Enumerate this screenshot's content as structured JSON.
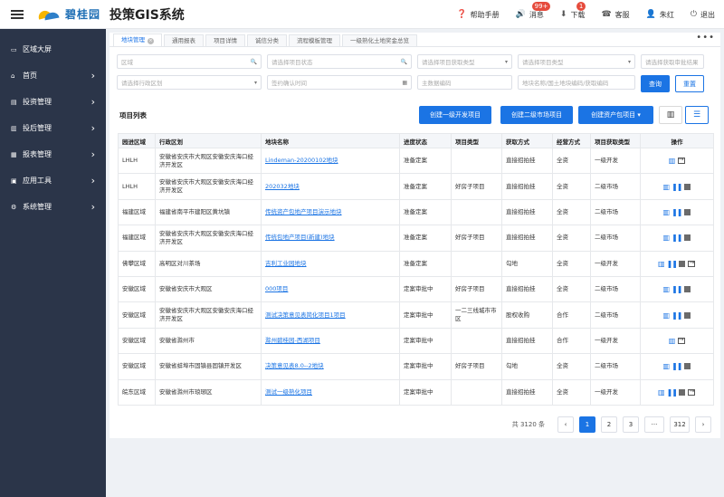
{
  "header": {
    "logo_text": "碧桂园",
    "system_title": "投策GIS系统",
    "actions": [
      {
        "icon": "help-icon",
        "glyph": "❓",
        "label": "帮助手册",
        "badge": ""
      },
      {
        "icon": "message-icon",
        "glyph": "🔊",
        "label": "消息",
        "badge": "99+"
      },
      {
        "icon": "download-icon",
        "glyph": "⬇",
        "label": "下载",
        "badge": "1"
      },
      {
        "icon": "service-icon",
        "glyph": "☎",
        "label": "客服",
        "badge": ""
      },
      {
        "icon": "user-icon",
        "glyph": "👤",
        "label": "朱红",
        "badge": ""
      },
      {
        "icon": "logout-icon",
        "glyph": "⏻",
        "label": "退出",
        "badge": ""
      }
    ]
  },
  "sidebar": {
    "items": [
      {
        "icon": "monitor-icon",
        "glyph": "▭",
        "label": "区域大屏",
        "has_arrow": false
      },
      {
        "icon": "home-icon",
        "glyph": "⌂",
        "label": "首页",
        "has_arrow": true
      },
      {
        "icon": "invest-icon",
        "glyph": "▤",
        "label": "投资管理",
        "has_arrow": true
      },
      {
        "icon": "post-invest-icon",
        "glyph": "▥",
        "label": "投后管理",
        "has_arrow": true
      },
      {
        "icon": "report-icon",
        "glyph": "▦",
        "label": "报表管理",
        "has_arrow": true
      },
      {
        "icon": "tools-icon",
        "glyph": "▣",
        "label": "应用工具",
        "has_arrow": true
      },
      {
        "icon": "settings-icon",
        "glyph": "⚙",
        "label": "系统管理",
        "has_arrow": true
      }
    ],
    "arrow_glyph": "›"
  },
  "tabs": {
    "items": [
      {
        "label": "地块管理",
        "active": true,
        "closable": true
      },
      {
        "label": "通用报表",
        "active": false,
        "closable": false
      },
      {
        "label": "项目详情",
        "active": false,
        "closable": false
      },
      {
        "label": "诚信分类",
        "active": false,
        "closable": false
      },
      {
        "label": "流程模板管理",
        "active": false,
        "closable": false
      },
      {
        "label": "一级熟化土地奖金总览",
        "active": false,
        "closable": false
      }
    ],
    "close_glyph": "×",
    "more_glyph": "•••"
  },
  "filters": {
    "row1": [
      {
        "placeholder": "区域",
        "suffix": "🔍",
        "width": 160
      },
      {
        "placeholder": "请选择项目状态",
        "suffix": "🔍",
        "width": 160
      },
      {
        "placeholder": "请选择项目获取类型",
        "suffix": "▾",
        "width": 105
      },
      {
        "placeholder": "请选择项目类型",
        "suffix": "▾",
        "width": 130
      },
      {
        "placeholder": "请选择获取审批结果",
        "suffix": "",
        "width": 70
      }
    ],
    "row2": [
      {
        "placeholder": "请选择行政区划",
        "suffix": "▾",
        "width": 160
      },
      {
        "placeholder": "签约确认时间",
        "suffix": "▦",
        "width": 160
      },
      {
        "placeholder": "主数据编码",
        "suffix": "",
        "width": 105
      },
      {
        "placeholder": "地块名称/国土地块编码/获取编码",
        "suffix": "",
        "width": 130
      }
    ],
    "search_label": "查询",
    "reset_label": "重置"
  },
  "list": {
    "title": "项目列表",
    "btn_primary_dev": "创建一级开发项目",
    "btn_secondary_market": "创建二级市场项目",
    "btn_asset_package": "创建资产包项目 ▾",
    "view_map_glyph": "▥",
    "view_list_glyph": "☰"
  },
  "table": {
    "columns": [
      "园进区域",
      "行政区划",
      "地块名称",
      "进度状态",
      "项目类型",
      "获取方式",
      "经营方式",
      "项目获取类型",
      "操作"
    ],
    "rows": [
      {
        "region": "LHLH",
        "admin": "安徽省安庆市大观区安徽安庆海口经济开发区",
        "name": "Lindeman-20200102地块",
        "status": "准备定案",
        "ptype": "",
        "method": "直接招拍挂",
        "mode": "全资",
        "acq": "一级开发",
        "ops": [
          "map",
          "exit"
        ]
      },
      {
        "region": "LHLH",
        "admin": "安徽省安庆市大观区安徽安庆海口经济开发区",
        "name": "202032地块",
        "status": "准备定案",
        "ptype": "好房子项目",
        "method": "直接招拍挂",
        "mode": "全资",
        "acq": "二级市场",
        "ops": [
          "map",
          "pause",
          "stop"
        ]
      },
      {
        "region": "福建区域",
        "admin": "福建省南平市建阳区黄坑镇",
        "name": "传统资产包地产项目演示地块",
        "status": "准备定案",
        "ptype": "",
        "method": "直接招拍挂",
        "mode": "全资",
        "acq": "二级市场",
        "ops": [
          "map",
          "pause",
          "stop"
        ]
      },
      {
        "region": "福建区域",
        "admin": "安徽省安庆市大观区安徽安庆海口经济开发区",
        "name": "传统包地产项目(新建)地块",
        "status": "准备定案",
        "ptype": "好房子项目",
        "method": "直接招拍挂",
        "mode": "全资",
        "acq": "二级市场",
        "ops": [
          "map",
          "pause",
          "stop"
        ]
      },
      {
        "region": "佛攀区域",
        "admin": "高明区对川茶场",
        "name": "吉利工业园地块",
        "status": "准备定案",
        "ptype": "",
        "method": "勾地",
        "mode": "全资",
        "acq": "一级开发",
        "ops": [
          "map",
          "pause",
          "stop",
          "exit"
        ]
      },
      {
        "region": "安徽区域",
        "admin": "安徽省安庆市大观区",
        "name": "000项目",
        "status": "定案审批中",
        "ptype": "好房子项目",
        "method": "直接招拍挂",
        "mode": "全资",
        "acq": "二级市场",
        "ops": [
          "map",
          "pause",
          "stop"
        ]
      },
      {
        "region": "安徽区域",
        "admin": "安徽省安庆市大观区安徽安庆海口经济开发区",
        "name": "测试决策意见表简化项目1项目",
        "status": "定案审批中",
        "ptype": "一二三线城市市区",
        "method": "股权收购",
        "mode": "合作",
        "acq": "二级市场",
        "ops": [
          "map",
          "pause",
          "stop"
        ]
      },
      {
        "region": "安徽区域",
        "admin": "安徽省滁州市",
        "name": "滁州碧桂园-西湖项目",
        "status": "定案审批中",
        "ptype": "",
        "method": "直接招拍挂",
        "mode": "合作",
        "acq": "一级开发",
        "ops": [
          "map",
          "exit"
        ]
      },
      {
        "region": "安徽区域",
        "admin": "安徽省蚌埠市固镇县固镇开发区",
        "name": "决策意见表8.0--2地块",
        "status": "定案审批中",
        "ptype": "好房子项目",
        "method": "勾地",
        "mode": "全资",
        "acq": "二级市场",
        "ops": [
          "map",
          "pause",
          "stop"
        ]
      },
      {
        "region": "皖东区域",
        "admin": "安徽省滁州市琅琊区",
        "name": "测试一级熟化项目",
        "status": "定案审批中",
        "ptype": "",
        "method": "直接招拍挂",
        "mode": "全资",
        "acq": "一级开发",
        "ops": [
          "map",
          "pause",
          "stop",
          "exit"
        ]
      }
    ]
  },
  "pagination": {
    "total_text": "共 3120 条",
    "prev_glyph": "‹",
    "pages": [
      "1",
      "2",
      "3",
      "···",
      "312"
    ],
    "active_page": "1",
    "next_glyph": "›"
  },
  "colors": {
    "primary": "#1b74e4",
    "sidebar_bg": "#2b3549",
    "badge": "#e64b3c"
  }
}
